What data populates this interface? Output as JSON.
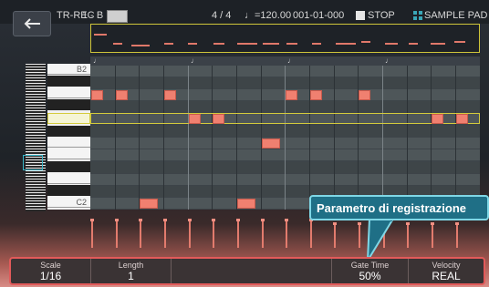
{
  "header": {
    "back_label": "←",
    "mode": "TR-REC",
    "pattern": "1 - B",
    "time_signature": "4 / 4",
    "tempo": "♩=120.00",
    "position": "001-01-000",
    "stop_label": "STOP",
    "sample_pad_label": "SAMPLE PAD"
  },
  "piano_roll": {
    "top_key_label": "B2",
    "bottom_key_label": "C2",
    "beat_marker": "♩"
  },
  "callout": {
    "text": "Parametro di registrazione"
  },
  "params": [
    {
      "label": "Scale",
      "value": "1/16"
    },
    {
      "label": "Length",
      "value": "1"
    },
    {
      "label": "Gate Time",
      "value": "50%"
    },
    {
      "label": "Velocity",
      "value": "REAL"
    }
  ],
  "colors": {
    "note": "#f08070",
    "selection": "#d4cb3c",
    "highlight": "#e25a5a",
    "callout": "#1f6f86"
  }
}
